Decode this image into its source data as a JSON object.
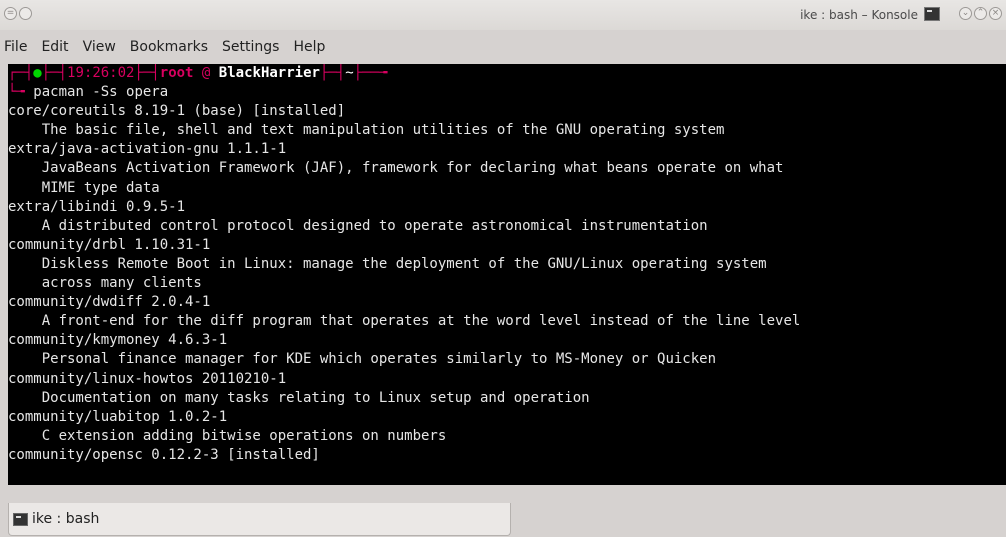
{
  "window": {
    "title": "ike : bash – Konsole",
    "left_buttons": [
      "menu",
      "pin"
    ],
    "right_buttons": [
      "minimize",
      "maximize",
      "close"
    ]
  },
  "menu": {
    "items": [
      "File",
      "Edit",
      "View",
      "Bookmarks",
      "Settings",
      "Help"
    ]
  },
  "terminal": {
    "prompt": {
      "time": "19:26:02",
      "user": "root",
      "at": "@",
      "host": "BlackHarrier",
      "dir": "~"
    },
    "command": "pacman -Ss opera",
    "lines": [
      "core/coreutils 8.19-1 (base) [installed]",
      "    The basic file, shell and text manipulation utilities of the GNU operating system",
      "extra/java-activation-gnu 1.1.1-1",
      "    JavaBeans Activation Framework (JAF), framework for declaring what beans operate on what",
      "    MIME type data",
      "extra/libindi 0.9.5-1",
      "    A distributed control protocol designed to operate astronomical instrumentation",
      "community/drbl 1.10.31-1",
      "    Diskless Remote Boot in Linux: manage the deployment of the GNU/Linux operating system",
      "    across many clients",
      "community/dwdiff 2.0.4-1",
      "    A front-end for the diff program that operates at the word level instead of the line level",
      "community/kmymoney 4.6.3-1",
      "    Personal finance manager for KDE which operates similarly to MS-Money or Quicken",
      "community/linux-howtos 20110210-1",
      "    Documentation on many tasks relating to Linux setup and operation",
      "community/luabitop 1.0.2-1",
      "    C extension adding bitwise operations on numbers",
      "community/opensc 0.12.2-3 [installed]"
    ]
  },
  "tabs": [
    {
      "label": "ike : bash",
      "icon": "terminal-icon"
    }
  ]
}
